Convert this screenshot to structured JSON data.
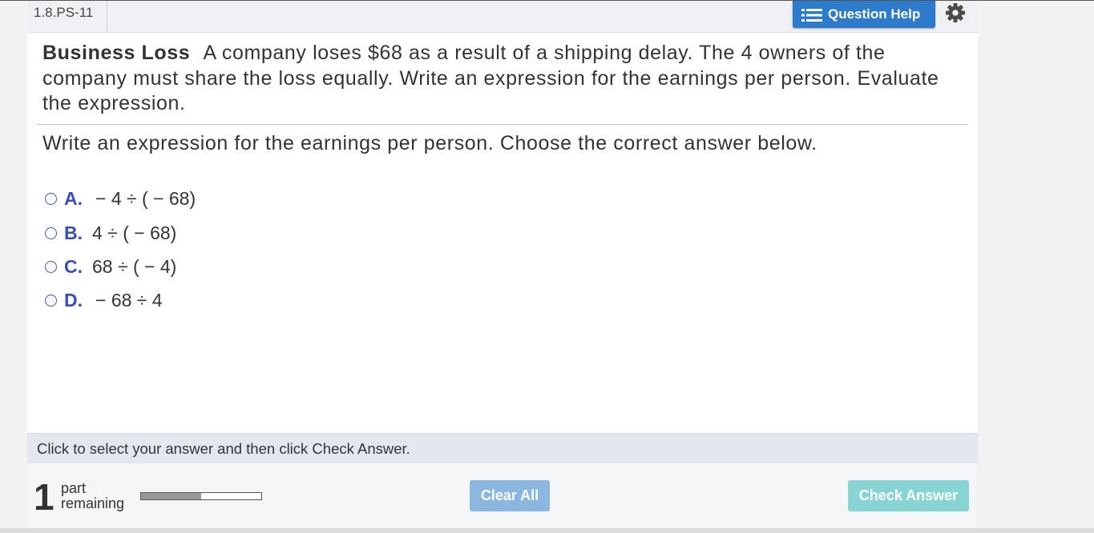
{
  "header": {
    "problem_id": "1.8.PS-11",
    "help_label": "Question Help",
    "help_icon": "list-icon",
    "settings_icon": "gear-icon"
  },
  "problem": {
    "title": "Business Loss",
    "text": "A company loses $68 as a result of a shipping delay. The 4 owners of the company must share the loss equally. Write an expression for the earnings per person. Evaluate the expression."
  },
  "instruction": "Write an expression for the earnings per person. Choose the correct answer below.",
  "choices": [
    {
      "letter": "A.",
      "expression": "− 4 ÷ ( − 68)"
    },
    {
      "letter": "B.",
      "expression": "4 ÷ ( − 68)"
    },
    {
      "letter": "C.",
      "expression": "68 ÷ ( − 4)"
    },
    {
      "letter": "D.",
      "expression": "− 68 ÷ 4"
    }
  ],
  "hint": "Click to select your answer and then click Check Answer.",
  "footer": {
    "parts_remaining": "1",
    "parts_label_1": "part",
    "parts_label_2": "remaining",
    "progress_fraction": 0.5,
    "clear_label": "Clear All",
    "check_label": "Check Answer"
  },
  "colors": {
    "accent": "#2e7bcc",
    "choice_letter": "#3a4bbf",
    "clear_button": "#8bb6e0",
    "check_button": "#88d4d2"
  }
}
